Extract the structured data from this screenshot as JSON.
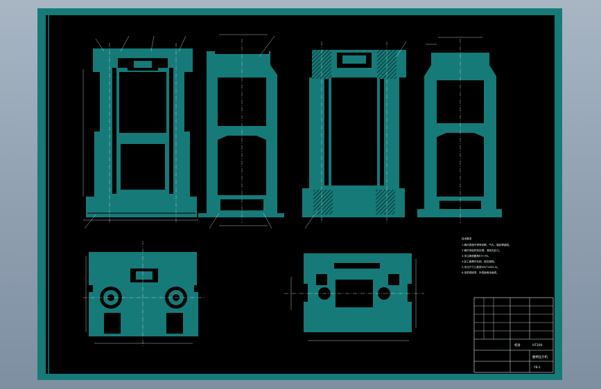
{
  "sheet": {
    "frame_color": "#167a78",
    "background_color": "#000000",
    "ink_color": "#e8f4f4"
  },
  "views": {
    "front_section": "front-section-view",
    "side_section": "side-section-view",
    "rear_section": "rear-section-view",
    "end_section": "end-section-view",
    "plan_view": "plan-view",
    "bottom_view": "bottom-view"
  },
  "notes": {
    "heading": "技术要求",
    "lines": [
      "1.铸件表面不得有砂眼、气孔、裂纹等缺陷。",
      "2.铸件须经时效处理，消除内应力。",
      "3.未注铸造圆角R3～R5。",
      "4.加工面需去毛刺，锐边倒钝。",
      "5.未注尺寸公差按GB/T1804-m。",
      "6.涂防锈底漆，外表面喷涂面漆。"
    ]
  },
  "title_block": {
    "name": "机身",
    "material": "HT200",
    "drawing_title": "曲柄压力机",
    "drawing_no": "YB-1"
  }
}
